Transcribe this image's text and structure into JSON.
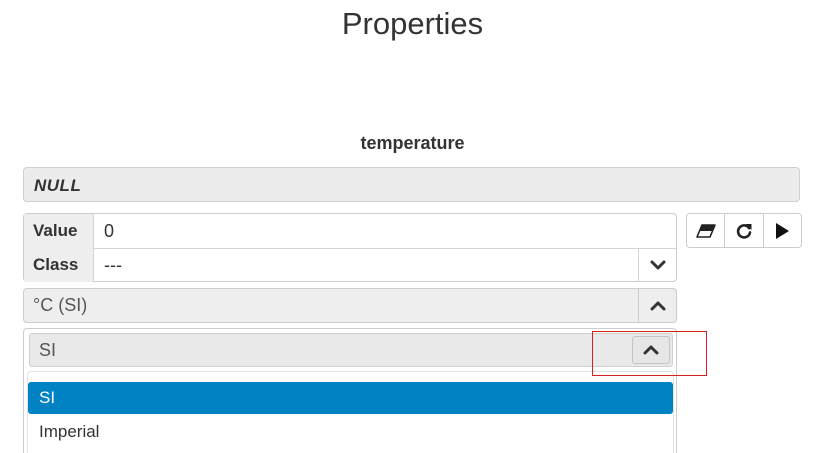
{
  "page": {
    "title": "Properties"
  },
  "section": {
    "title": "temperature"
  },
  "null_bar": {
    "text": "NULL"
  },
  "properties": {
    "value": {
      "label": "Value",
      "value": "0"
    },
    "class": {
      "label": "Class",
      "value": "---",
      "icon": "chevron-down-icon"
    }
  },
  "toolbar": {
    "buttons": [
      {
        "name": "eraser-button",
        "icon": "eraser-icon"
      },
      {
        "name": "refresh-button",
        "icon": "refresh-icon"
      },
      {
        "name": "play-button",
        "icon": "play-icon"
      }
    ]
  },
  "unit_dropdown": {
    "selected": "°C (SI)",
    "icon": "chevron-up-icon"
  },
  "unit_system_dropdown": {
    "selected": "SI",
    "icon": "chevron-up-icon",
    "options": [
      "SI",
      "Imperial"
    ],
    "highlighted_option": "SI"
  },
  "colors": {
    "selected_option_bg": "#0082c3",
    "annotation_box": "#d62020"
  }
}
